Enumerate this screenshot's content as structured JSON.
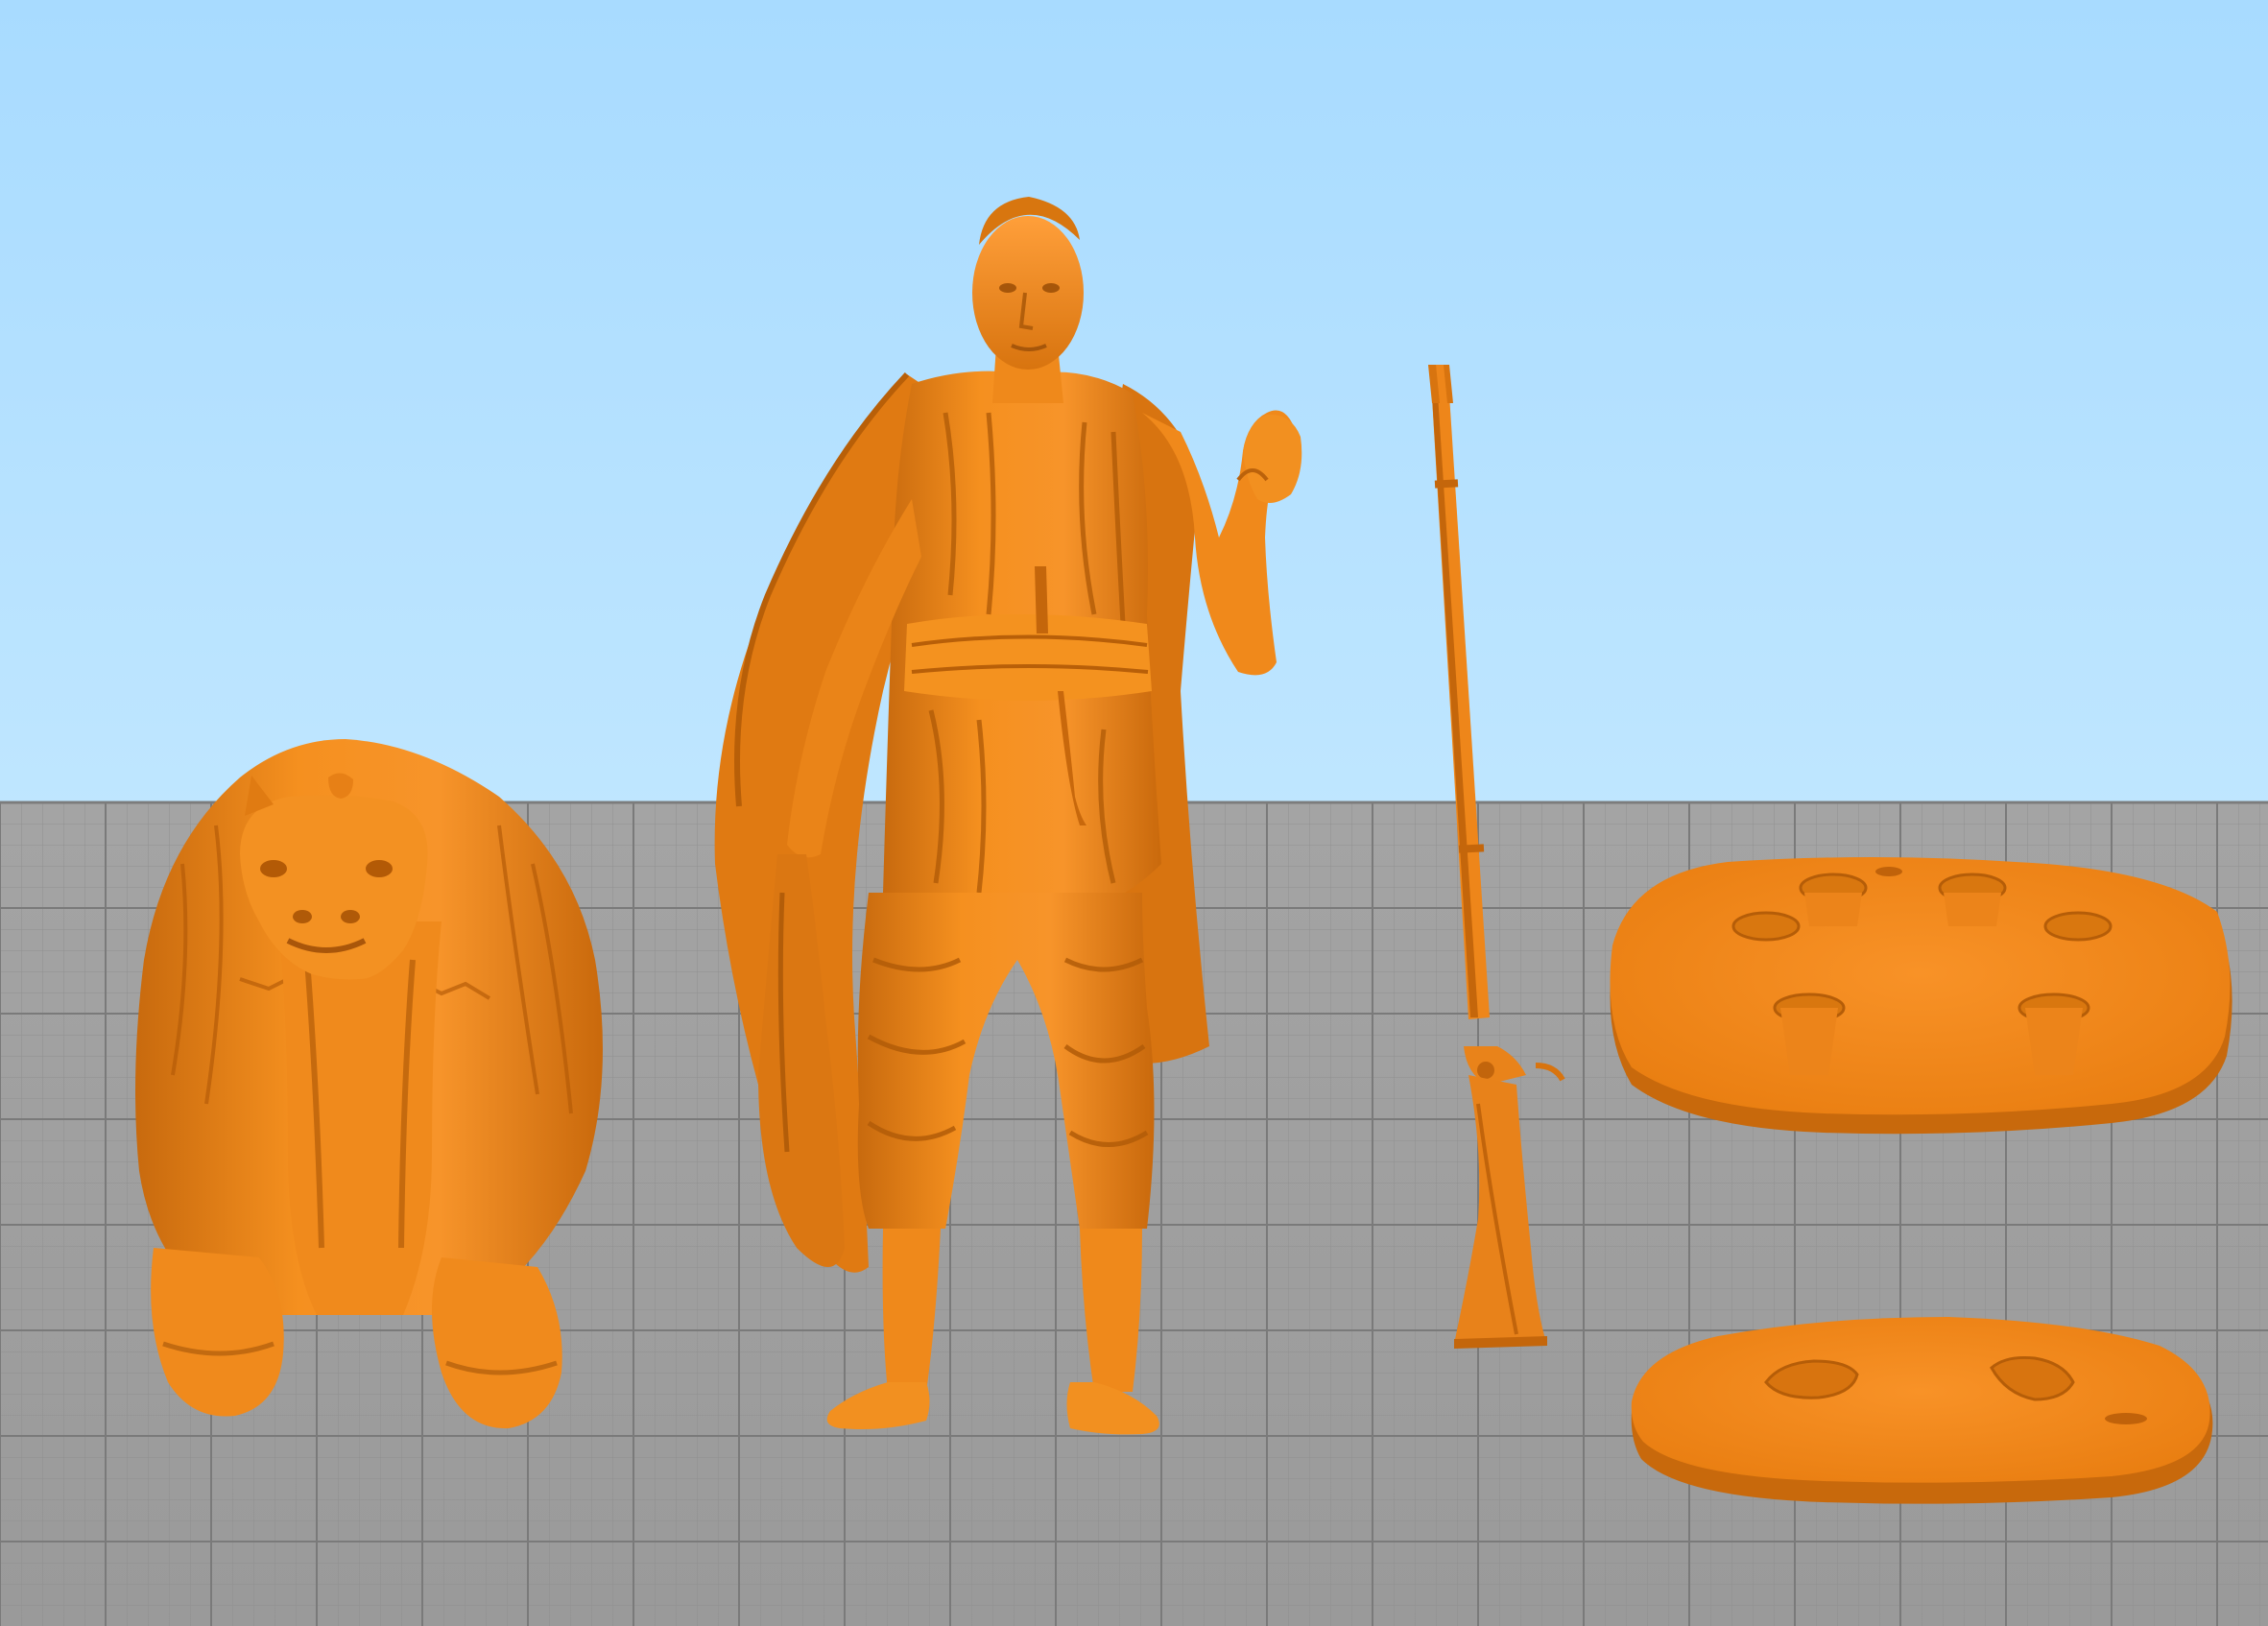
{
  "viewport": {
    "colors": {
      "sky_top": "#a9dcff",
      "sky_bottom": "#bfe6ff",
      "bed": "#a0a0a0",
      "grid_minor": "#8f8f8f",
      "grid_major": "#7a7a7a",
      "model": "#f0861a",
      "model_shadow": "#b85e0a",
      "model_highlight": "#ffa347"
    }
  },
  "objects": [
    {
      "name": "camel",
      "icon": "camel-model-icon"
    },
    {
      "name": "standing-figure",
      "icon": "person-model-icon"
    },
    {
      "name": "rifle",
      "icon": "rifle-model-icon"
    },
    {
      "name": "base-large",
      "icon": "base-model-icon"
    },
    {
      "name": "base-small",
      "icon": "base-model-icon"
    }
  ]
}
